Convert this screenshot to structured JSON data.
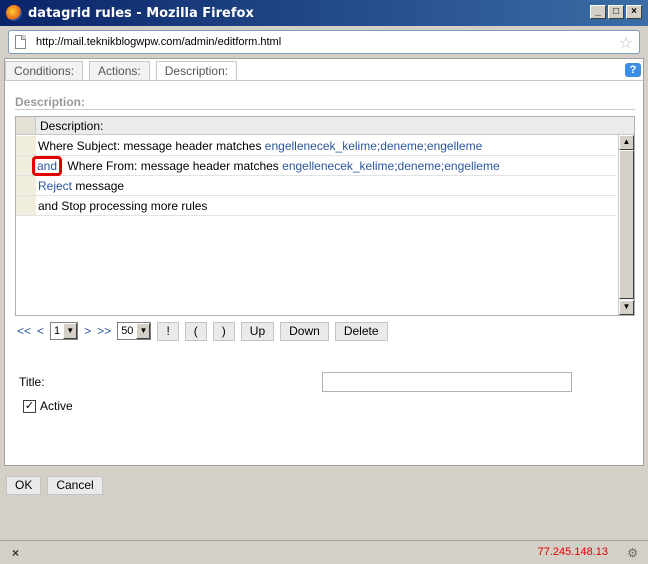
{
  "window": {
    "title": "datagrid rules - Mozilla Firefox",
    "min_glyph": "_",
    "max_glyph": "□",
    "close_glyph": "×"
  },
  "urlbar": {
    "url": "http://mail.teknikblogwpw.com/admin/editform.html"
  },
  "tabs": [
    {
      "label": "Conditions:"
    },
    {
      "label": "Actions:"
    },
    {
      "label": "Description:"
    }
  ],
  "help_glyph": "?",
  "section": {
    "title": "Description:"
  },
  "grid": {
    "header": "Description:",
    "rows": [
      {
        "pre_link": "",
        "text": "Where Subject: message header matches",
        "link": "engellenecek_kelime;deneme;engelleme"
      },
      {
        "pre_link": "and",
        "text": "Where From: message header matches",
        "link": "engellenecek_kelime;deneme;engelleme"
      },
      {
        "pre_link": "Reject",
        "text": "message",
        "link": ""
      },
      {
        "pre_link": "",
        "text": "and Stop processing more rules",
        "link": ""
      }
    ]
  },
  "pager": {
    "first": "<<",
    "prev": "<",
    "page": "1",
    "next": ">",
    "last": ">>",
    "page_size": "50",
    "buttons": [
      "!",
      "(",
      ")",
      "Up",
      "Down",
      "Delete"
    ]
  },
  "form": {
    "title_label": "Title:",
    "title_value": "",
    "active_label": "Active",
    "active_checked": true,
    "check_glyph": "✓"
  },
  "actions": {
    "ok": "OK",
    "cancel": "Cancel"
  },
  "status": {
    "close_glyph": "×",
    "ip": "77.245.148.13"
  }
}
